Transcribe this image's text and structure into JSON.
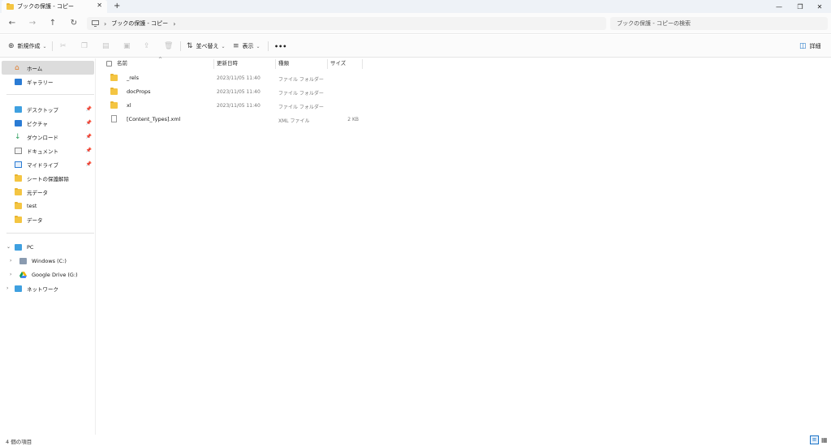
{
  "window": {
    "tab_title": "ブックの保護 - コピー",
    "new_tab": "+",
    "controls": {
      "minimize": "—",
      "restore": "❐",
      "close": "✕"
    }
  },
  "addressbar": {
    "back": "←",
    "forward": "→",
    "up": "↑",
    "refresh": "↻",
    "pc_icon": "monitor-icon",
    "breadcrumb": "ブックの保護 - コピー",
    "search_placeholder": "ブックの保護 - コピーの検索"
  },
  "toolbar": {
    "new_label": "新規作成",
    "sort_label": "並べ替え",
    "view_label": "表示",
    "more_label": "•••",
    "details_label": "詳細"
  },
  "sidebar": {
    "home": "ホーム",
    "gallery": "ギャラリー",
    "quick": [
      {
        "label": "デスクトップ",
        "pinned": true
      },
      {
        "label": "ピクチャ",
        "pinned": true
      },
      {
        "label": "ダウンロード",
        "pinned": true
      },
      {
        "label": "ドキュメント",
        "pinned": true
      },
      {
        "label": "マイドライブ",
        "pinned": true
      },
      {
        "label": "シートの保護解除",
        "pinned": false
      },
      {
        "label": "元データ",
        "pinned": false
      },
      {
        "label": "test",
        "pinned": false
      },
      {
        "label": "データ",
        "pinned": false
      }
    ],
    "pc": "PC",
    "drives": [
      "Windows (C:)",
      "Google Drive (G:)"
    ],
    "network": "ネットワーク"
  },
  "columns": {
    "name": "名前",
    "modified": "更新日時",
    "type": "種類",
    "size": "サイズ"
  },
  "files": [
    {
      "name": "_rels",
      "modified": "2023/11/05 11:40",
      "type": "ファイル フォルダー",
      "size": "",
      "icon": "folder-icon"
    },
    {
      "name": "docProps",
      "modified": "2023/11/05 11:40",
      "type": "ファイル フォルダー",
      "size": "",
      "icon": "folder-icon"
    },
    {
      "name": "xl",
      "modified": "2023/11/05 11:40",
      "type": "ファイル フォルダー",
      "size": "",
      "icon": "folder-icon"
    },
    {
      "name": "[Content_Types].xml",
      "modified": "",
      "type": "XML ファイル",
      "size": "2 KB",
      "icon": "xml-file-icon"
    }
  ],
  "status": {
    "item_count": "4 個の項目"
  },
  "colors": {
    "folder": "#f4c542",
    "selected": "#dcdcdc",
    "accent": "#1a73c7"
  }
}
